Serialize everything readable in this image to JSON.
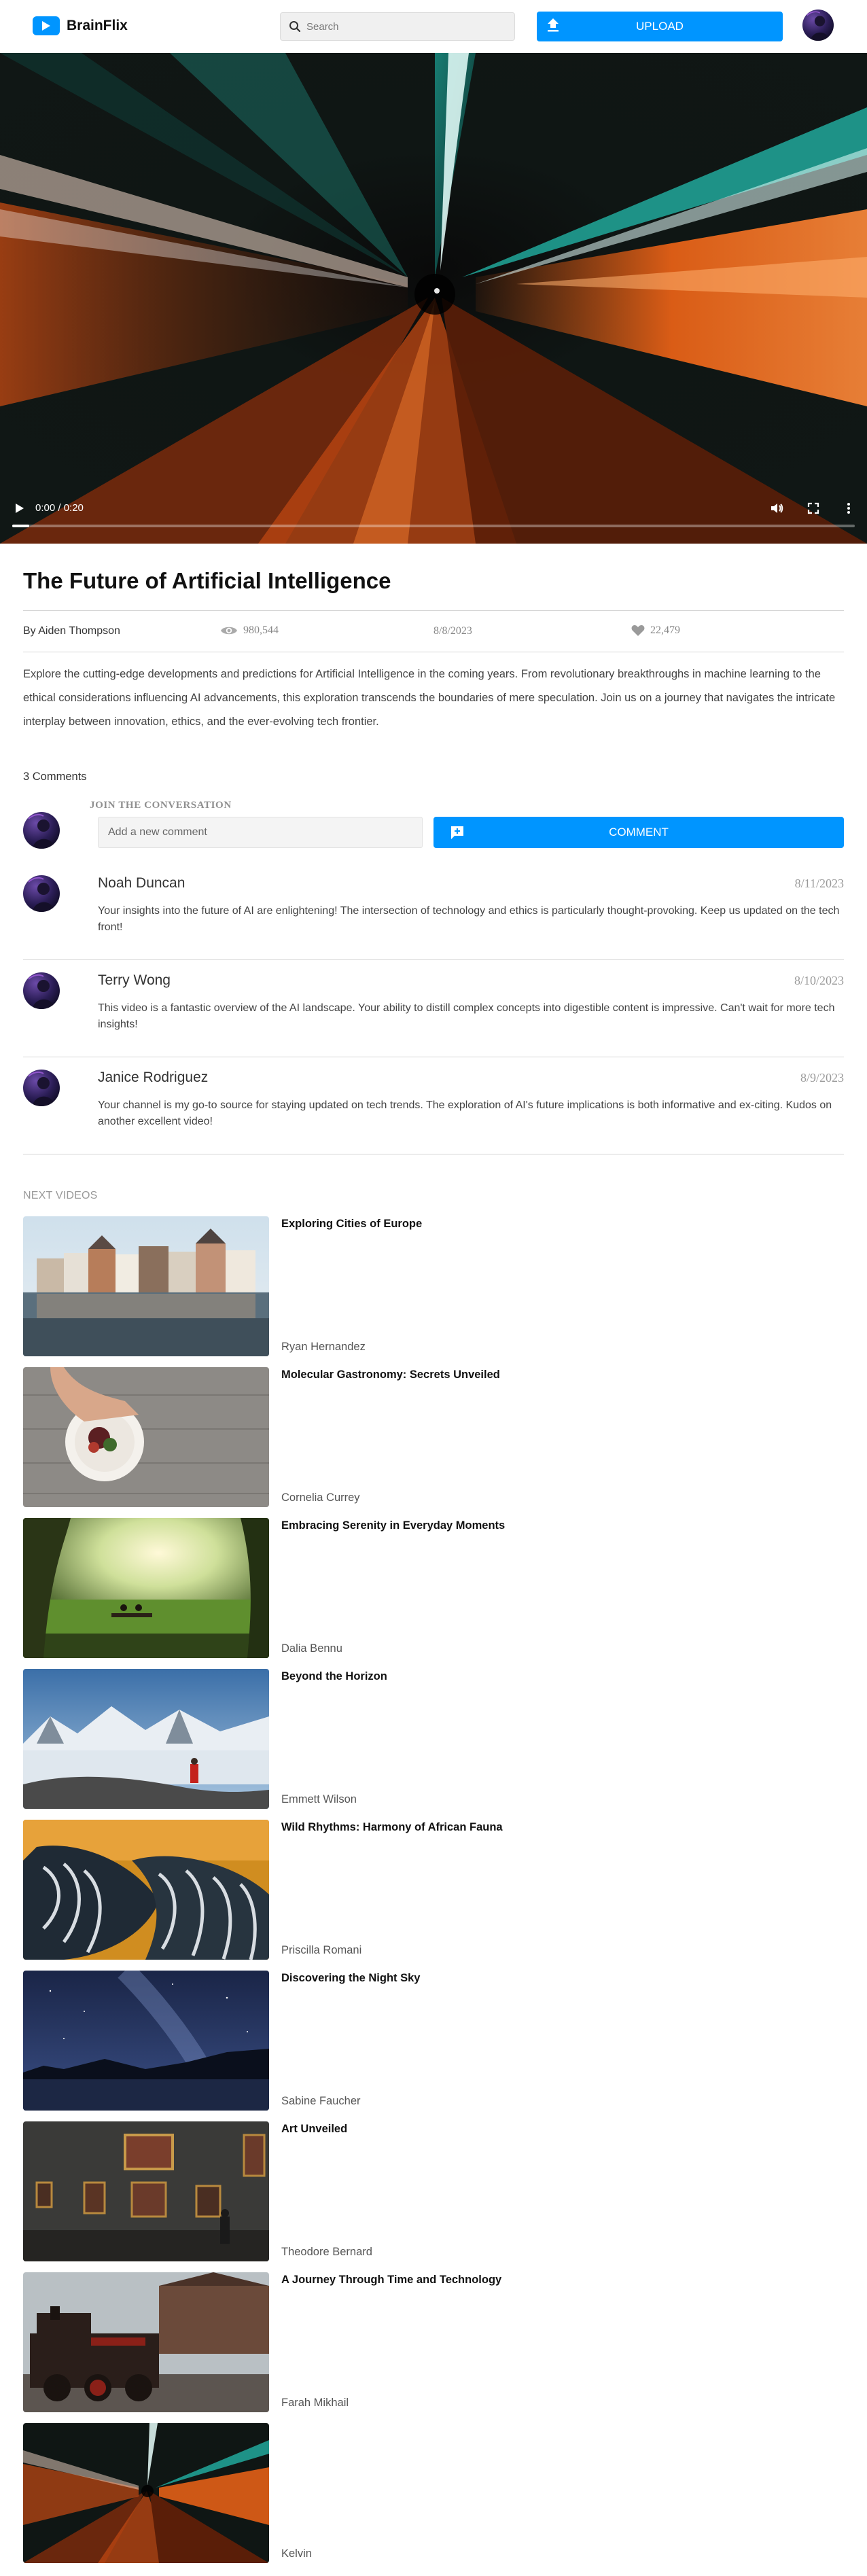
{
  "header": {
    "brand": "BrainFlix",
    "search_placeholder": "Search",
    "upload_label": "UPLOAD"
  },
  "video": {
    "time": "0:00 / 0:20",
    "progress": 0.02
  },
  "main": {
    "title": "The Future of Artificial Intelligence",
    "author": "By Aiden Thompson",
    "views": "980,544",
    "date": "8/8/2023",
    "likes": "22,479",
    "description": "Explore the cutting-edge developments and predictions for Artificial Intelligence in the coming years. From revolutionary breakthroughs in machine learning to the ethical considerations influencing AI advancements, this exploration transcends the boundaries of mere speculation. Join us on a journey that navigates the intricate interplay between innovation, ethics, and the ever-evolving tech frontier."
  },
  "comments": {
    "count_label": "3 Comments",
    "join_label": "JOIN THE CONVERSATION",
    "input_placeholder": "Add a new comment",
    "button_label": "COMMENT",
    "items": [
      {
        "name": "Noah Duncan",
        "date": "8/11/2023",
        "text": "Your insights into the future of AI are enlightening! The intersection of technology and ethics is particularly thought-provoking. Keep us updated on the tech front!"
      },
      {
        "name": "Terry Wong",
        "date": "8/10/2023",
        "text": "This video is a fantastic overview of the AI landscape. Your ability to distill complex concepts into digestible content is impressive. Can't wait for more tech insights!"
      },
      {
        "name": "Janice Rodriguez",
        "date": "8/9/2023",
        "text": "Your channel is my go-to source for staying updated on tech trends. The exploration of AI's future implications is both informative and ex-citing. Kudos on another excellent video!"
      }
    ]
  },
  "next_videos": {
    "label": "NEXT VIDEOS",
    "items": [
      {
        "title": "Exploring Cities of Europe",
        "author": "Ryan Hernandez"
      },
      {
        "title": "Molecular Gastronomy: Secrets Unveiled",
        "author": "Cornelia Currey"
      },
      {
        "title": "Embracing Serenity in Everyday Moments",
        "author": "Dalia Bennu"
      },
      {
        "title": "Beyond the Horizon",
        "author": "Emmett Wilson"
      },
      {
        "title": "Wild Rhythms: Harmony of African Fauna",
        "author": "Priscilla Romani"
      },
      {
        "title": "Discovering the Night Sky",
        "author": "Sabine Faucher"
      },
      {
        "title": "Art Unveiled",
        "author": "Theodore Bernard"
      },
      {
        "title": "A Journey Through Time and Technology",
        "author": "Farah Mikhail"
      },
      {
        "title": "",
        "author": "Kelvin"
      }
    ]
  }
}
